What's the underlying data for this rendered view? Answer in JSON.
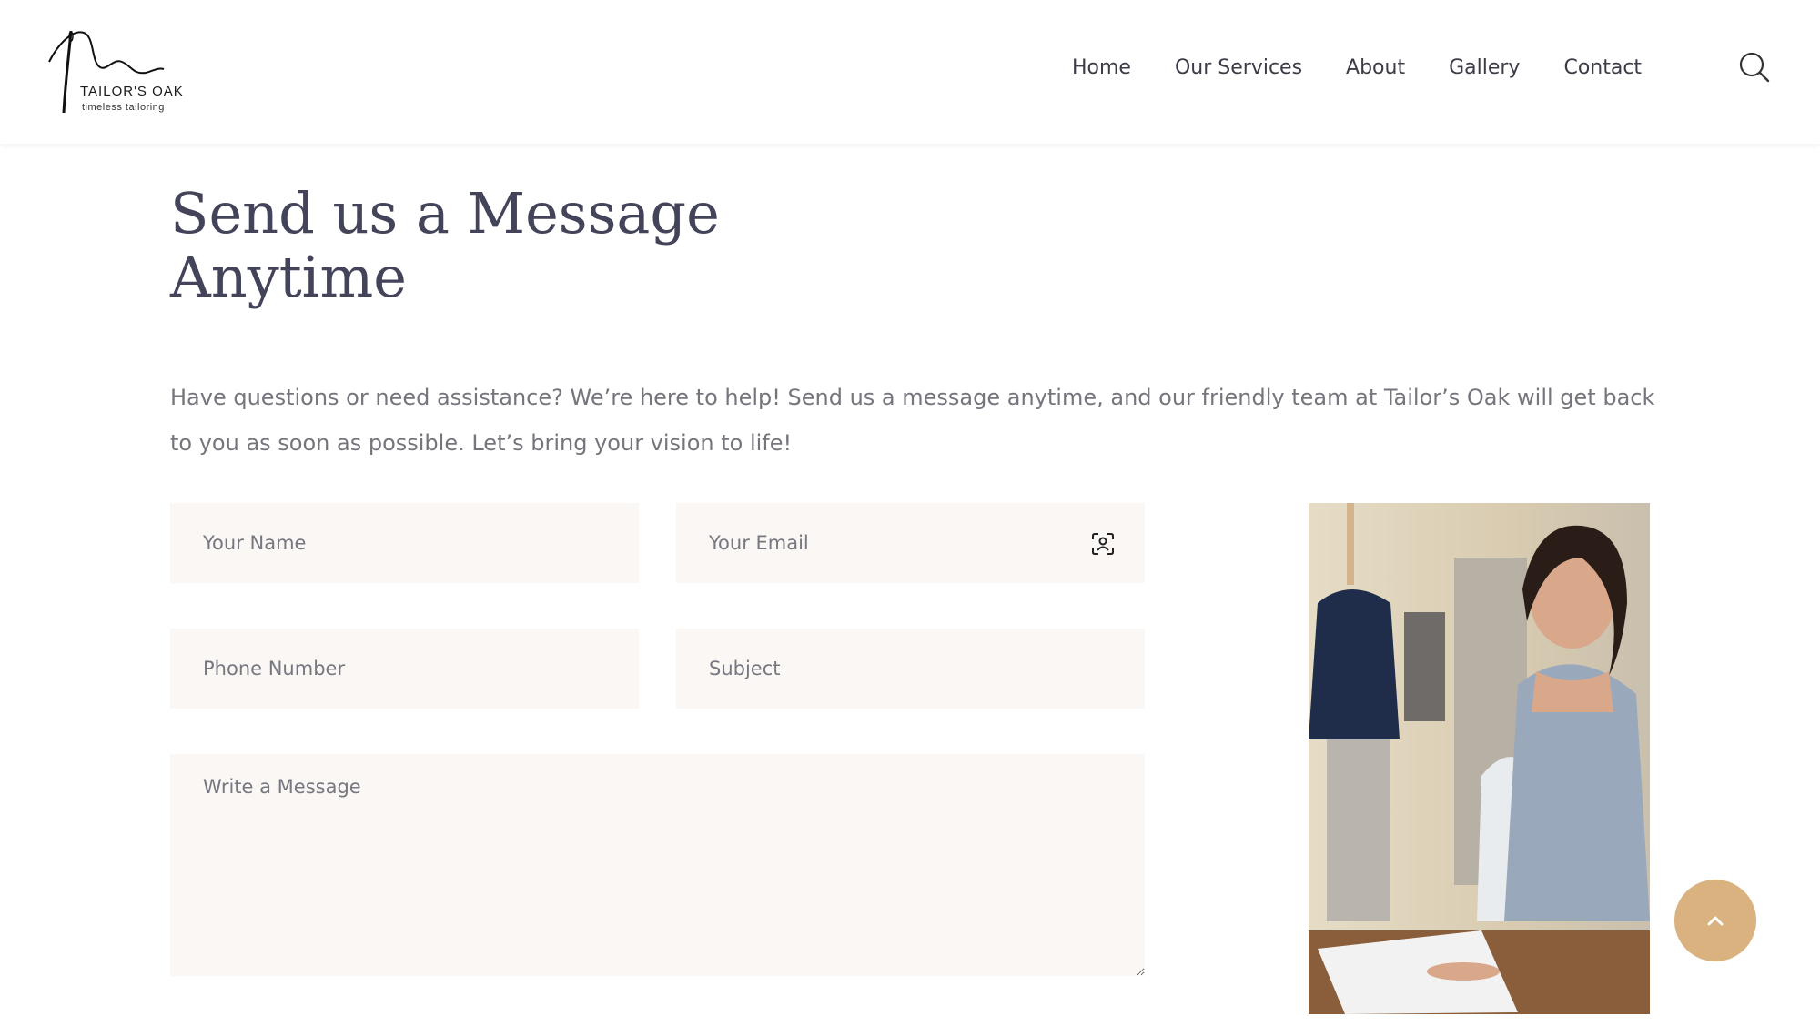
{
  "logo": {
    "brand": "TAILOR'S OAK",
    "tagline": "timeless tailoring"
  },
  "nav": {
    "items": [
      {
        "label": "Home"
      },
      {
        "label": "Our Services"
      },
      {
        "label": "About"
      },
      {
        "label": "Gallery"
      },
      {
        "label": "Contact"
      }
    ],
    "search_icon": "search-icon"
  },
  "main": {
    "title_line1": "Send us a Message",
    "title_line2": "Anytime",
    "intro": "Have questions or need assistance? We’re here to help! Send us a message anytime, and our friendly team at Tailor’s Oak will get back to you as soon as possible. Let’s bring your vision to life!"
  },
  "form": {
    "name_placeholder": "Your Name",
    "email_placeholder": "Your Email",
    "phone_placeholder": "Phone Number",
    "subject_placeholder": "Subject",
    "message_placeholder": "Write a Message",
    "email_autofill_icon": "contact-card-icon"
  },
  "scroll_top_icon": "chevron-up-icon",
  "colors": {
    "accent": "#d9b27f",
    "field_bg": "#faf7f4",
    "heading": "#43435a",
    "body_text": "#75757e"
  }
}
